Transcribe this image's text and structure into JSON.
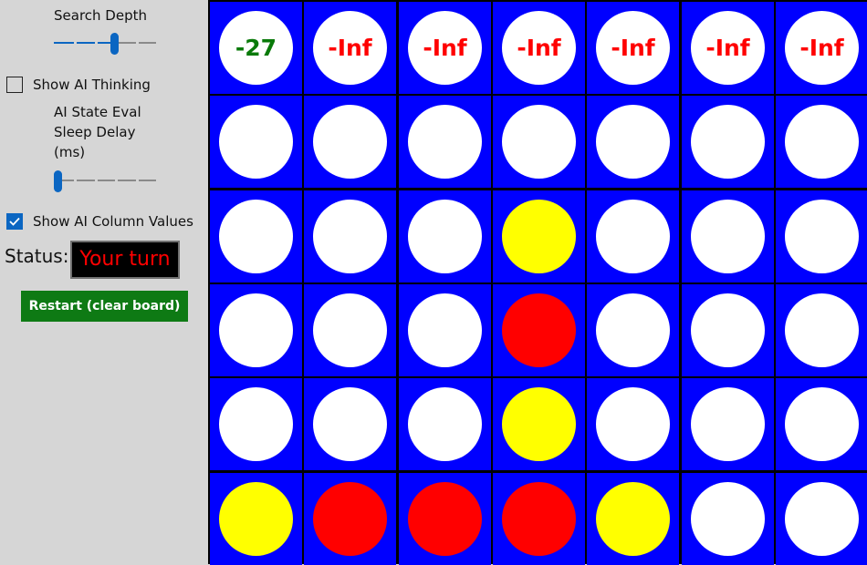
{
  "sidebar": {
    "search_depth_label": "Search Depth",
    "search_depth_value": 3,
    "search_depth_max": 5,
    "show_ai_thinking_label": "Show AI Thinking",
    "show_ai_thinking_checked": false,
    "sleep_delay_label_line1": "AI State Eval",
    "sleep_delay_label_line2": "Sleep Delay",
    "sleep_delay_label_line3": "(ms)",
    "sleep_delay_value": 0,
    "show_column_values_label": "Show AI Column Values",
    "show_column_values_checked": true,
    "status_label": "Status:",
    "status_text": "Your turn",
    "restart_label": "Restart (clear board)"
  },
  "colors": {
    "board_blue": "#0000ff",
    "red_piece": "#ff0000",
    "yellow_piece": "#ffff00",
    "empty_slot": "#ffffff",
    "positive_value": "#0a7a0a",
    "negative_inf": "#ff0000",
    "restart_button": "#0e7a14",
    "accent": "#0b66c2"
  },
  "board": {
    "columns": 7,
    "rows": 6,
    "column_values": [
      "-27",
      "-Inf",
      "-Inf",
      "-Inf",
      "-Inf",
      "-Inf",
      "-Inf"
    ],
    "cells": [
      [
        "empty",
        "empty",
        "empty",
        "empty",
        "empty",
        "empty",
        "empty"
      ],
      [
        "empty",
        "empty",
        "empty",
        "empty",
        "empty",
        "empty",
        "empty"
      ],
      [
        "empty",
        "empty",
        "empty",
        "yellow",
        "empty",
        "empty",
        "empty"
      ],
      [
        "empty",
        "empty",
        "empty",
        "red",
        "empty",
        "empty",
        "empty"
      ],
      [
        "empty",
        "empty",
        "empty",
        "yellow",
        "empty",
        "empty",
        "empty"
      ],
      [
        "yellow",
        "red",
        "red",
        "red",
        "yellow",
        "empty",
        "empty"
      ]
    ]
  }
}
